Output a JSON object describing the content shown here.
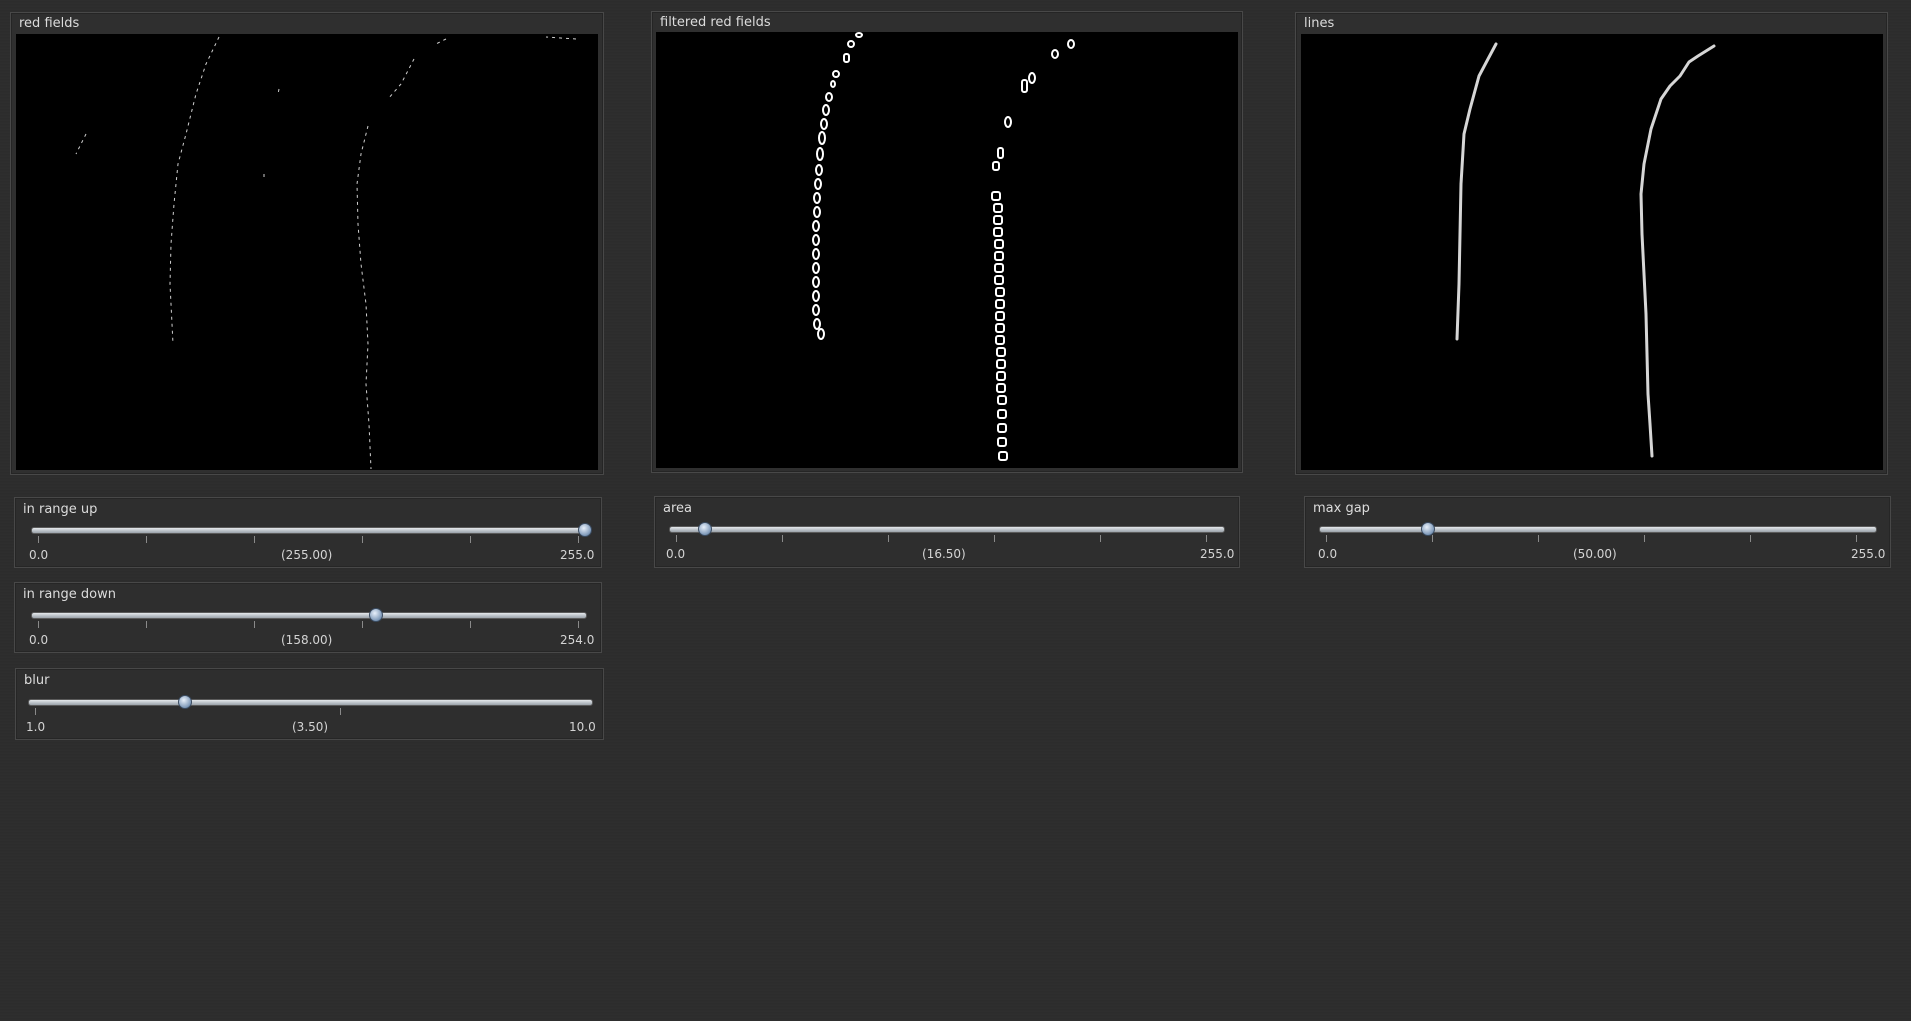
{
  "panels": {
    "red_fields": {
      "title": "red fields"
    },
    "filtered_red_fields": {
      "title": "filtered red fields"
    },
    "lines": {
      "title": "lines"
    }
  },
  "sliders": {
    "in_range_up": {
      "label": "in range up",
      "min": "0.0",
      "current": "(255.00)",
      "max": "255.0",
      "level": 1.0
    },
    "in_range_down": {
      "label": "in range down",
      "min": "0.0",
      "current": "(158.00)",
      "max": "254.0",
      "level": 0.622
    },
    "blur": {
      "label": "blur",
      "min": "1.0",
      "current": "(3.50)",
      "max": "10.0",
      "level": 0.278
    },
    "area": {
      "label": "area",
      "min": "0.0",
      "current": "(16.50)",
      "max": "255.0",
      "level": 0.065
    },
    "max_gap": {
      "label": "max gap",
      "min": "0.0",
      "current": "(50.00)",
      "max": "255.0",
      "level": 0.196
    }
  },
  "colors": {
    "background": "#2c2c2c",
    "view": "#000000",
    "trace": "#ffffff"
  }
}
